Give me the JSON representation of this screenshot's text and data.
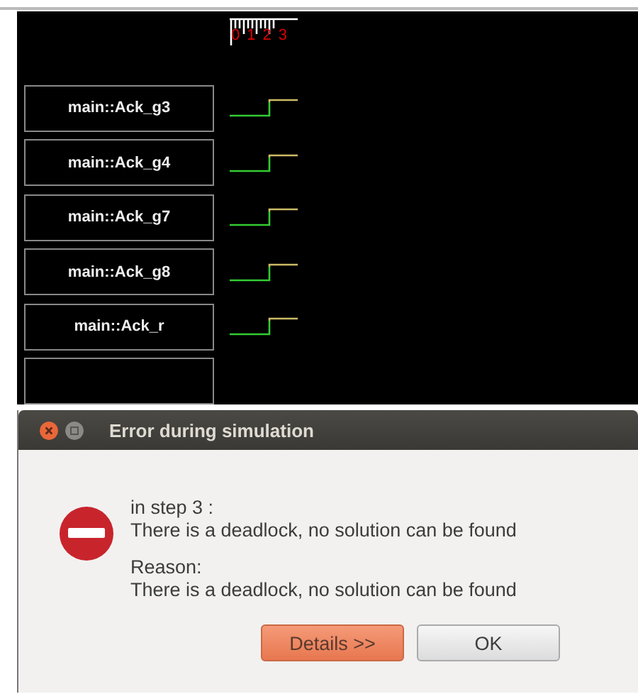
{
  "ruler": {
    "ticks": [
      "0",
      "1",
      "2",
      "3"
    ]
  },
  "signals": [
    {
      "name": "main::Ack_g3"
    },
    {
      "name": "main::Ack_g4"
    },
    {
      "name": "main::Ack_g7"
    },
    {
      "name": "main::Ack_g8"
    },
    {
      "name": "main::Ack_r"
    }
  ],
  "dialog": {
    "title": "Error during simulation",
    "paragraphs": [
      [
        "in step 3 :",
        "There is a deadlock, no solution can be found"
      ],
      [
        "Reason:",
        "There is a deadlock, no solution can be found"
      ]
    ],
    "buttons": [
      {
        "label": "Details >>",
        "default": true
      },
      {
        "label": "OK",
        "default": false
      }
    ]
  }
}
